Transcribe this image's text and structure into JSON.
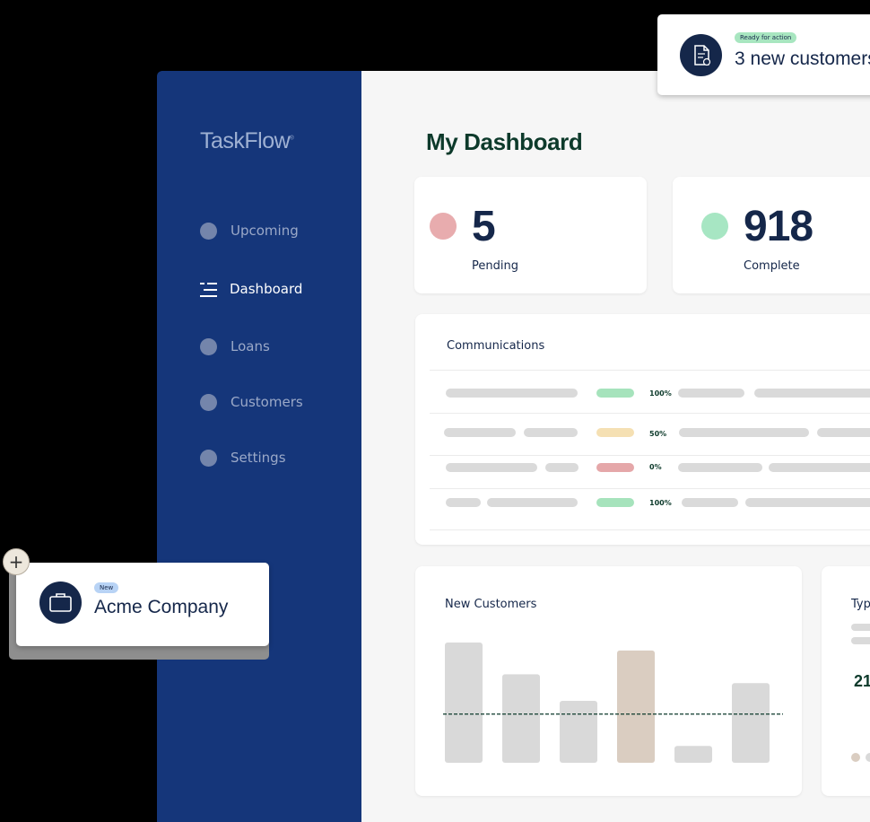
{
  "app": {
    "brand": "TaskFlow",
    "brand_mark": "®"
  },
  "sidebar": {
    "items": [
      {
        "label": "Upcoming",
        "active": false
      },
      {
        "label": "Dashboard",
        "active": true,
        "icon": "list-icon"
      },
      {
        "label": "Loans",
        "active": false
      },
      {
        "label": "Customers",
        "active": false
      },
      {
        "label": "Settings",
        "active": false
      }
    ]
  },
  "main": {
    "title": "My Dashboard",
    "stats": [
      {
        "value": "5",
        "label": "Pending",
        "color": "#e8acae"
      },
      {
        "value": "918",
        "label": "Complete",
        "color": "#a7e6c3"
      }
    ],
    "communications": {
      "title": "Communications",
      "rows": [
        {
          "percent": "100%",
          "status_color": "#a6e3bc"
        },
        {
          "percent": "50%",
          "status_color": "#f5e0b3"
        },
        {
          "percent": "0%",
          "status_color": "#e5a7a9"
        },
        {
          "percent": "100%",
          "status_color": "#a6e3bc"
        }
      ]
    },
    "new_customers": {
      "title": "New Customers"
    },
    "type_card": {
      "title": "Typ",
      "number": "21"
    }
  },
  "notifications": {
    "top": {
      "badge": "Ready for action",
      "text": "3 new customers",
      "icon": "document-icon",
      "badge_color": "#a8e6c0"
    },
    "bottom": {
      "badge": "New",
      "text": "Acme Company",
      "icon": "briefcase-icon",
      "badge_color": "#b8d3f5"
    }
  },
  "chart_data": {
    "type": "bar",
    "title": "New Customers",
    "categories": [
      "",
      "",
      "",
      "",
      "",
      ""
    ],
    "values": [
      136,
      100,
      70,
      127,
      19,
      90
    ],
    "highlight_index": 3,
    "reference_line": 55,
    "ylim": [
      0,
      140
    ],
    "grid": false,
    "colors": {
      "bar": "#d9d9d9",
      "highlight": "#dacdc1",
      "reference": "#0d3a2b"
    }
  }
}
